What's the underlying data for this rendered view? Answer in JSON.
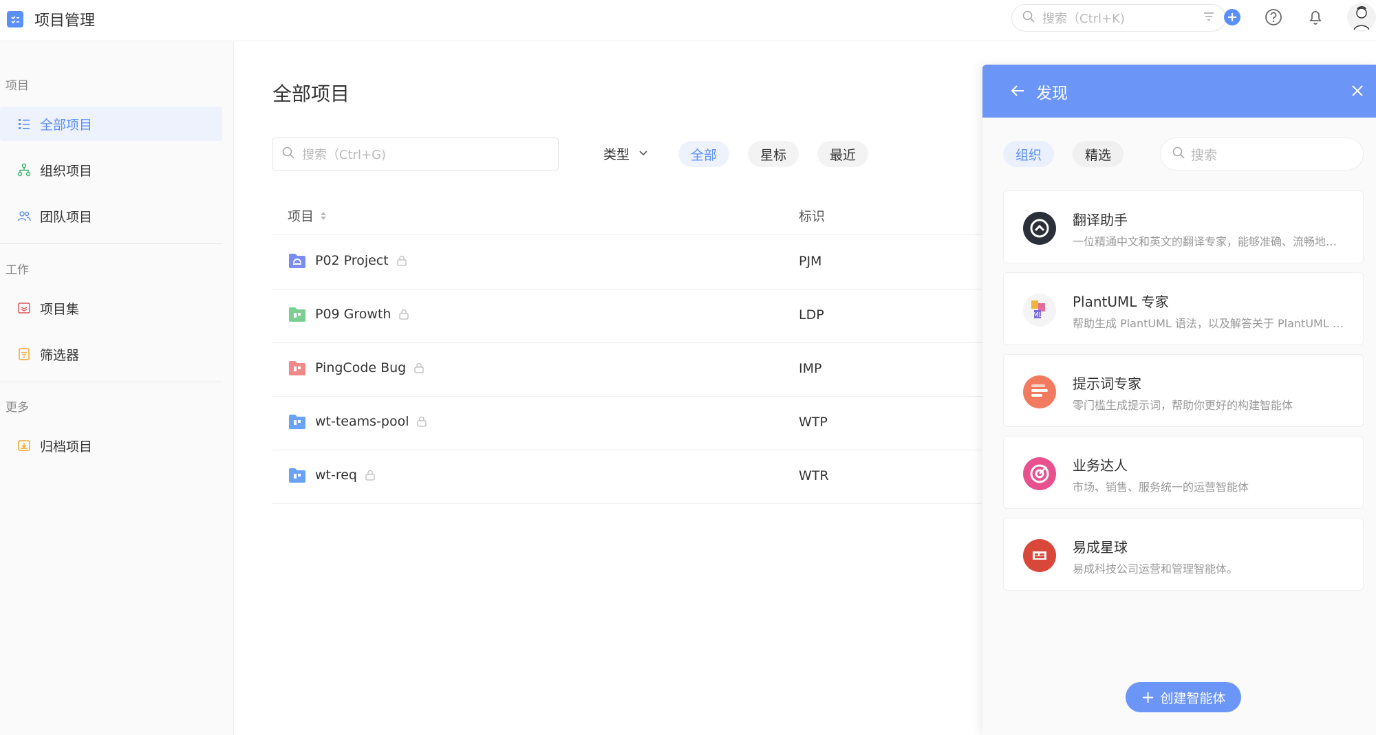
{
  "app": {
    "title": "项目管理"
  },
  "topbar": {
    "search_placeholder": "搜索（Ctrl+K)",
    "icons": [
      "filter-icon",
      "add-icon",
      "help-icon",
      "bell-icon",
      "avatar"
    ]
  },
  "sidebar": {
    "sections": [
      {
        "title": "项目"
      },
      {
        "title": "工作"
      },
      {
        "title": "更多"
      }
    ],
    "items": [
      {
        "label": "全部项目",
        "icon": "list-icon",
        "active": true
      },
      {
        "label": "组织项目",
        "icon": "org-tree-icon"
      },
      {
        "label": "团队项目",
        "icon": "team-icon"
      },
      {
        "label": "项目集",
        "icon": "project-set-icon"
      },
      {
        "label": "筛选器",
        "icon": "filter-doc-icon"
      },
      {
        "label": "归档项目",
        "icon": "archive-icon"
      }
    ]
  },
  "main": {
    "title": "全部项目",
    "search_placeholder": "搜索（Ctrl+G)",
    "type_filter": "类型",
    "pills": [
      "全部",
      "星标",
      "最近"
    ],
    "columns": [
      "项目",
      "标识"
    ],
    "rows": [
      {
        "name": "P02 Project",
        "code": "PJM",
        "color": "#7b8cf0"
      },
      {
        "name": "P09 Growth",
        "code": "LDP",
        "color": "#7ccf93"
      },
      {
        "name": "PingCode Bug",
        "code": "IMP",
        "color": "#f08a8a"
      },
      {
        "name": "wt-teams-pool",
        "code": "WTP",
        "color": "#6aa3f5"
      },
      {
        "name": "wt-req",
        "code": "WTR",
        "color": "#6aa3f5"
      }
    ]
  },
  "panel": {
    "title": "发现",
    "tabs": [
      "组织",
      "精选"
    ],
    "search_placeholder": "搜索",
    "cards": [
      {
        "name": "翻译助手",
        "desc": "一位精通中文和英文的翻译专家，能够准确、流畅地…",
        "logo": "translate-logo"
      },
      {
        "name": "PlantUML 专家",
        "desc": "帮助生成 PlantUML 语法，以及解答关于 PlantUML …",
        "logo": "uml-logo"
      },
      {
        "name": "提示词专家",
        "desc": "零门槛生成提示词，帮助你更好的构建智能体",
        "logo": "prompt-logo"
      },
      {
        "name": "业务达人",
        "desc": "市场、销售、服务统一的运营智能体",
        "logo": "target-logo"
      },
      {
        "name": "易成星球",
        "desc": "易成科技公司运营和管理智能体。",
        "logo": "planet-logo"
      }
    ],
    "create_label": "创建智能体"
  },
  "colors": {
    "accent": "#5b8ff9",
    "panel_header": "#6b95f7"
  }
}
